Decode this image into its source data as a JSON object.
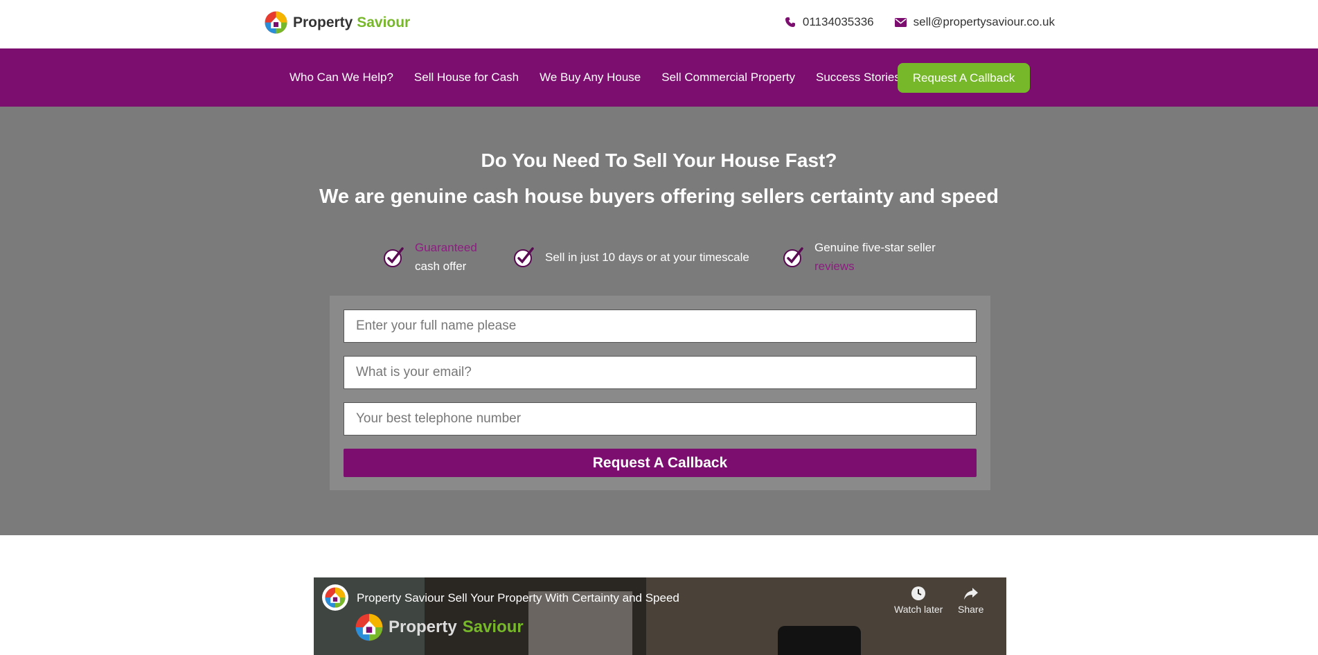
{
  "header": {
    "logo_word1": "Property",
    "logo_word2": "Saviour",
    "phone": "01134035336",
    "email": "sell@propertysaviour.co.uk"
  },
  "nav": {
    "items": [
      {
        "label": "Who Can We Help?"
      },
      {
        "label": "Sell House for Cash"
      },
      {
        "label": "We Buy Any House"
      },
      {
        "label": "Sell Commercial Property"
      },
      {
        "label": "Success Stories"
      }
    ],
    "cta_label": "Request A Callback"
  },
  "hero": {
    "title": "Do You Need To Sell Your House Fast?",
    "subtitle": "We are genuine cash house buyers offering sellers certainty and speed",
    "features": [
      {
        "highlight": "Guaranteed",
        "text": "cash offer"
      },
      {
        "text": "Sell in just 10 days or at your timescale"
      },
      {
        "text": "Genuine five-star seller",
        "highlight": "reviews"
      }
    ]
  },
  "form": {
    "name_placeholder": "Enter your full name please",
    "email_placeholder": "What is your email?",
    "phone_placeholder": "Your best telephone number",
    "submit_label": "Request A Callback"
  },
  "video": {
    "title": "Property Saviour Sell Your Property With Certainty and Speed",
    "brand_word1": "Property",
    "brand_word2": "Saviour",
    "watch_later_label": "Watch later",
    "share_label": "Share"
  },
  "colors": {
    "brand_purple": "#7b0e6f",
    "brand_green": "#76b82a",
    "hero_gray": "#7b7b7b"
  }
}
